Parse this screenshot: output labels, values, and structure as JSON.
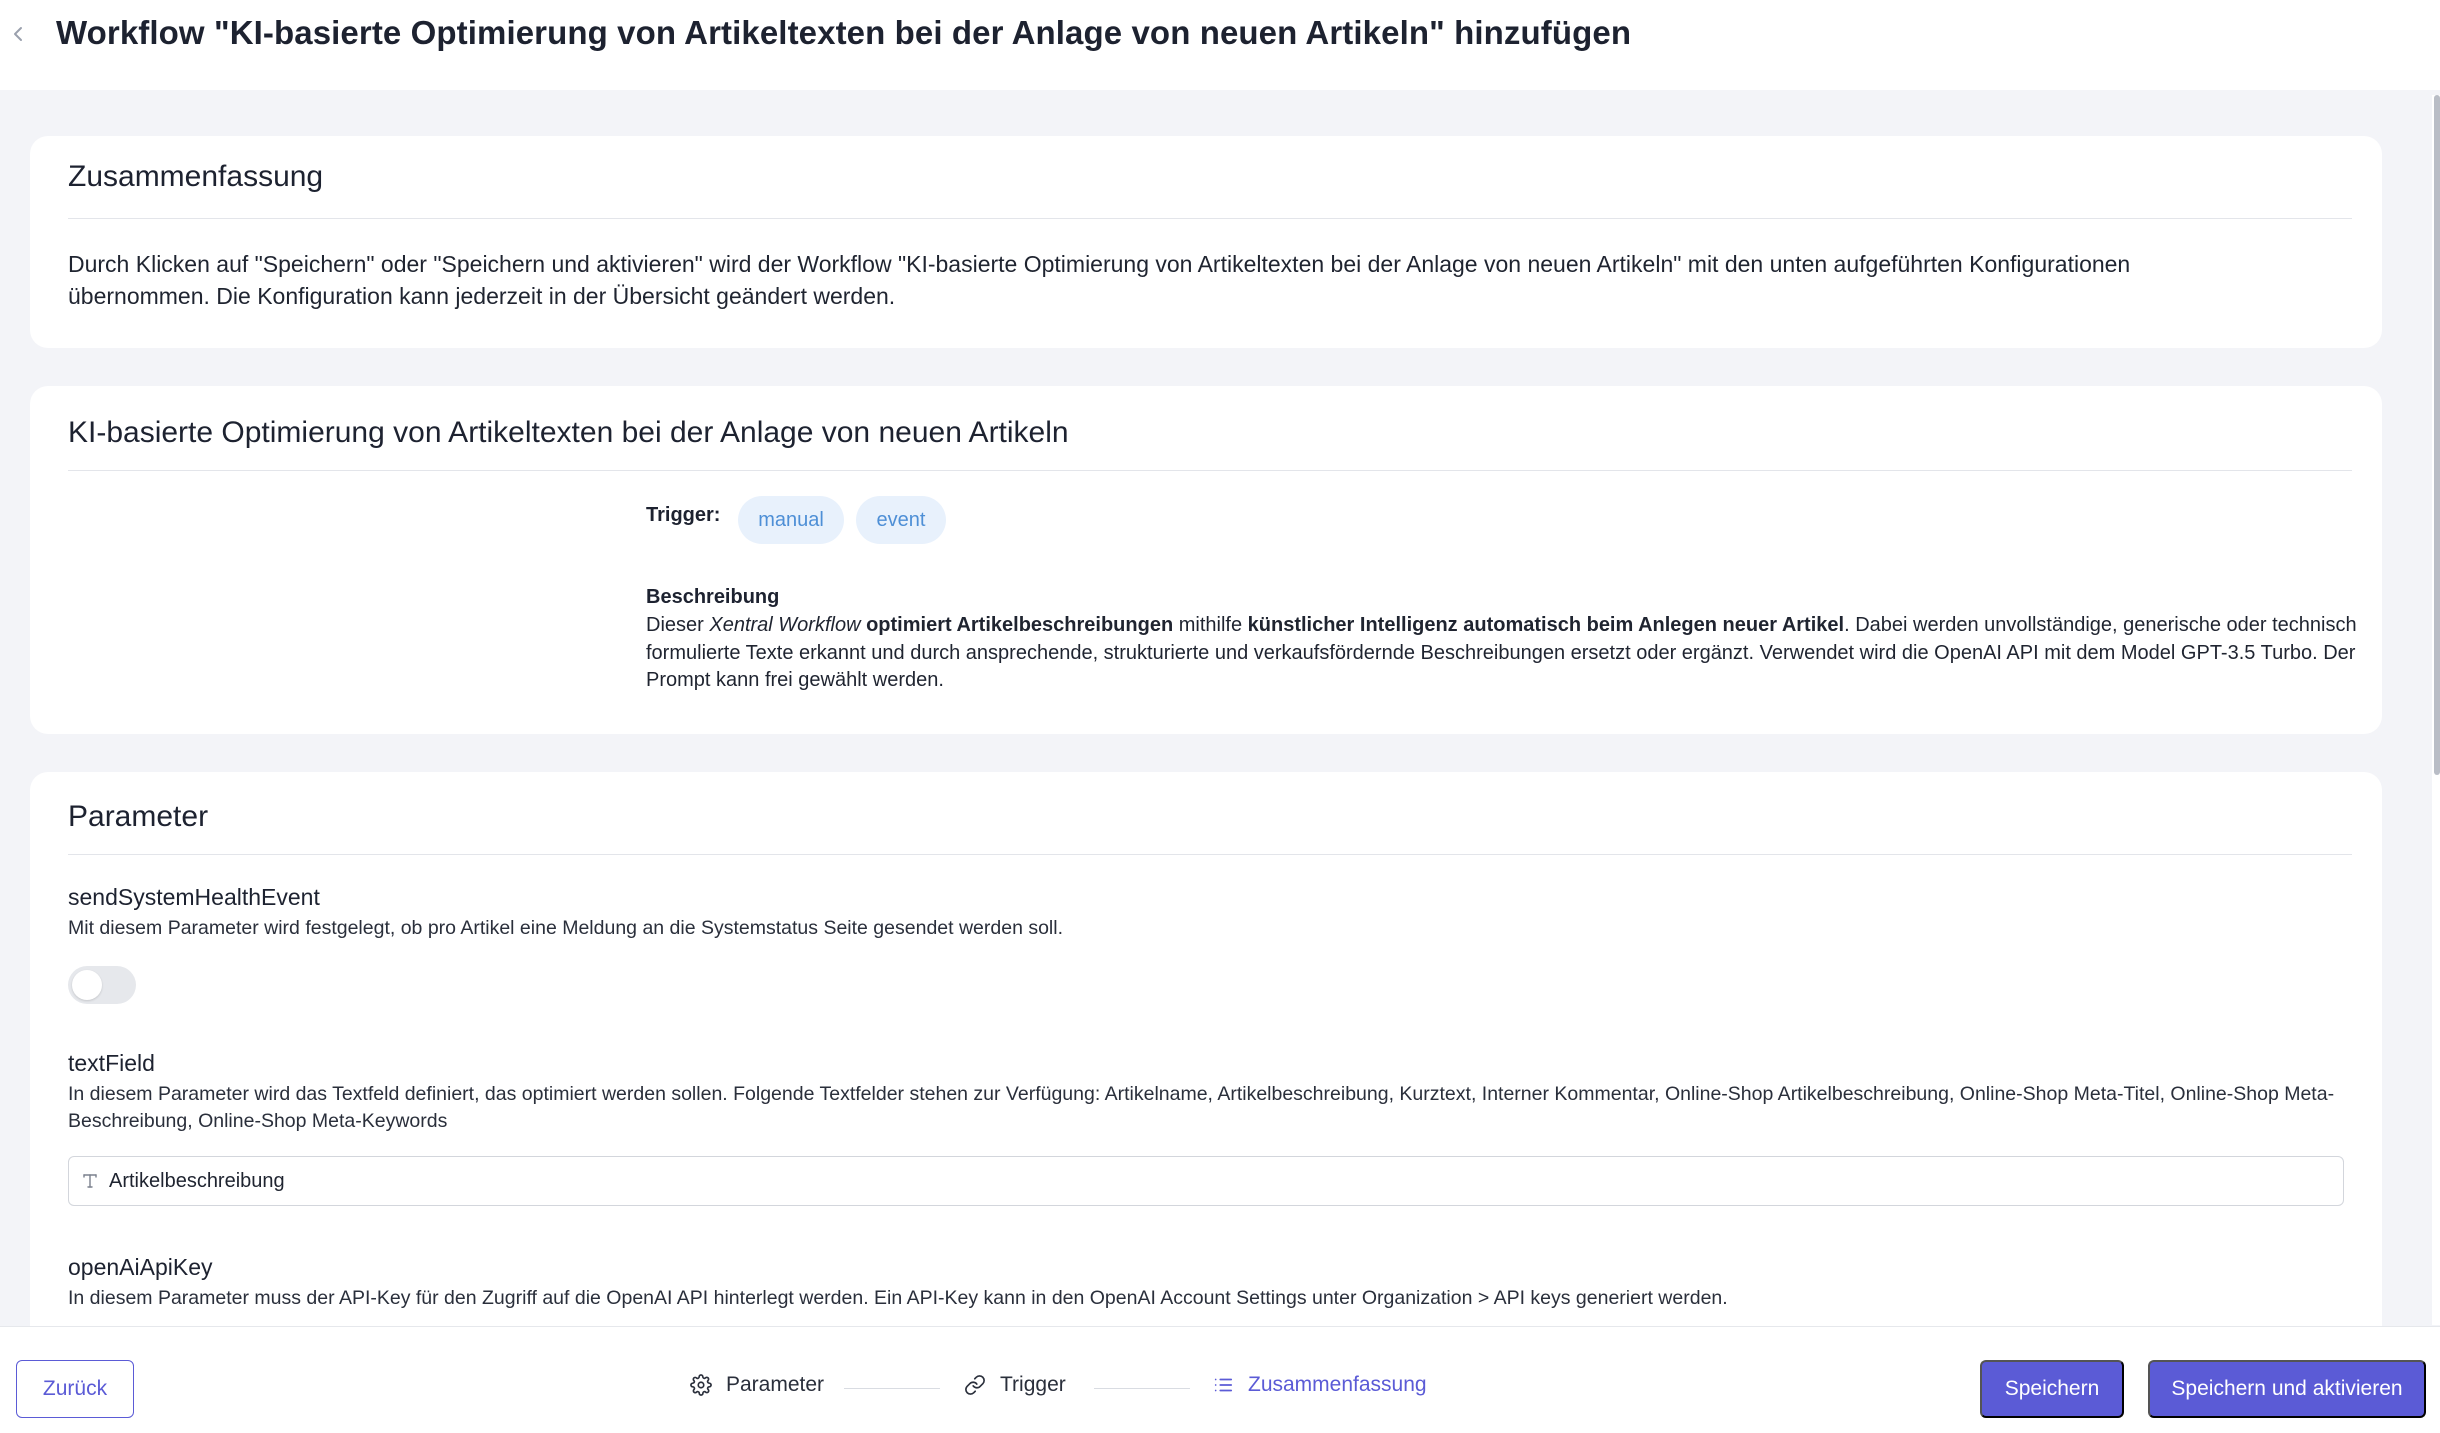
{
  "header": {
    "title": "Workflow \"KI-basierte Optimierung von Artikeltexten bei der Anlage von neuen Artikeln\" hinzufügen"
  },
  "summary_card": {
    "title": "Zusammenfassung",
    "text_line1": "Durch Klicken auf \"Speichern\" oder \"Speichern und aktivieren\" wird der Workflow \"KI-basierte Optimierung von Artikeltexten bei der Anlage von neuen Artikeln\" mit den unten aufgeführten Konfigurationen",
    "text_line2": "übernommen. Die Konfiguration kann jederzeit in der Übersicht geändert werden."
  },
  "workflow_card": {
    "title": "KI-basierte Optimierung von Artikeltexten bei der Anlage von neuen Artikeln",
    "trigger_label": "Trigger:",
    "triggers": [
      "manual",
      "event"
    ],
    "description_heading": "Beschreibung",
    "description": {
      "p1": "Dieser ",
      "p2_italic": "Xentral Workflow",
      "p3": " ",
      "p4_bold": "optimiert Artikelbeschreibungen",
      "p5": " mithilfe ",
      "p6_bold": "künstlicher Intelligenz automatisch beim Anlegen neuer Artikel",
      "p7": ". Dabei werden unvollständige, generische oder technisch formulierte Texte erkannt und durch ansprechende, strukturierte und verkaufsfördernde Beschreibungen ersetzt oder ergänzt. Verwendet wird die OpenAI API mit dem Model GPT-3.5 Turbo. Der Prompt kann frei gewählt werden."
    }
  },
  "parameter_card": {
    "title": "Parameter",
    "params": [
      {
        "name": "sendSystemHealthEvent",
        "description": "Mit diesem Parameter wird festgelegt, ob pro Artikel eine Meldung an die Systemstatus Seite gesendet werden soll.",
        "toggle_on": false
      },
      {
        "name": "textField",
        "description": "In diesem Parameter wird das Textfeld definiert, das optimiert werden sollen. Folgende Textfelder stehen zur Verfügung: Artikelname, Artikelbeschreibung, Kurztext, Interner Kommentar, Online-Shop Artikelbeschreibung, Online-Shop Meta-Titel, Online-Shop Meta-Beschreibung, Online-Shop Meta-Keywords",
        "value": "Artikelbeschreibung"
      },
      {
        "name": "openAiApiKey",
        "description": "In diesem Parameter muss der API-Key für den Zugriff auf die OpenAI API hinterlegt werden. Ein API-Key kann in den OpenAI Account Settings unter Organization > API keys generiert werden."
      }
    ]
  },
  "footer": {
    "back_label": "Zurück",
    "steps": [
      {
        "label": "Parameter",
        "icon": "gear-icon",
        "active": false
      },
      {
        "label": "Trigger",
        "icon": "link-icon",
        "active": false
      },
      {
        "label": "Zusammenfassung",
        "icon": "list-icon",
        "active": true
      }
    ],
    "save_label": "Speichern",
    "save_activate_label": "Speichern und aktivieren"
  },
  "colors": {
    "accent": "#5b5bd6",
    "chip_bg": "#e8f1fc",
    "chip_text": "#4e8fd6",
    "page_bg": "#f3f4f8"
  }
}
